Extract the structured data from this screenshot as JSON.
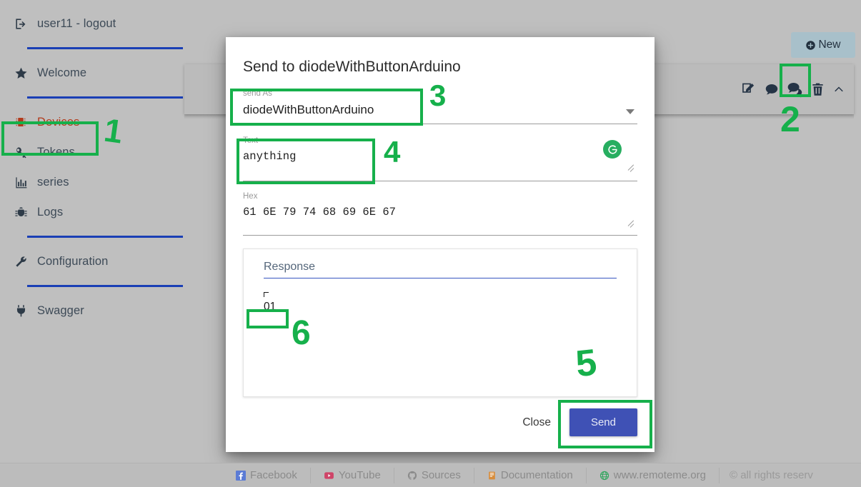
{
  "sidebar": {
    "account": {
      "label": "user11 - logout",
      "icon": "sign-out-icon"
    },
    "items": [
      {
        "label": "Welcome",
        "icon": "star-icon",
        "active": false
      },
      {
        "label": "Devices",
        "icon": "chip-icon",
        "active": true
      },
      {
        "label": "Tokens",
        "icon": "key-icon",
        "active": false
      },
      {
        "label": "series",
        "icon": "chart-icon",
        "active": false
      },
      {
        "label": "Logs",
        "icon": "bug-icon",
        "active": false
      },
      {
        "label": "Configuration",
        "icon": "wrench-icon",
        "active": false
      },
      {
        "label": "Swagger",
        "icon": "plug-icon",
        "active": false
      }
    ]
  },
  "toolbar": {
    "new_label": "New",
    "new_icon": "plus-circle-icon",
    "card_icons": [
      {
        "name": "edit-icon",
        "highlighted": false
      },
      {
        "name": "comment-icon",
        "highlighted": false
      },
      {
        "name": "comments-icon",
        "highlighted": true
      },
      {
        "name": "trash-icon",
        "highlighted": false
      },
      {
        "name": "chevron-up-icon",
        "highlighted": false
      }
    ]
  },
  "modal": {
    "title": "Send to diodeWithButtonArduino",
    "fields": {
      "send_as": {
        "label": "send As",
        "value": "diodeWithButtonArduino",
        "caret_icon": "chevron-down-icon"
      },
      "text": {
        "label": "Text",
        "value": "anything",
        "refresh_icon": "refresh-icon"
      },
      "hex": {
        "label": "Hex",
        "value": "61 6E 79 74 68 69 6E 67"
      }
    },
    "response": {
      "label": "Response",
      "value": "01"
    },
    "actions": {
      "close_label": "Close",
      "send_label": "Send"
    }
  },
  "footer": {
    "links": [
      {
        "label": "Facebook",
        "icon": "facebook-icon"
      },
      {
        "label": "YouTube",
        "icon": "youtube-icon"
      },
      {
        "label": "Sources",
        "icon": "github-icon"
      },
      {
        "label": "Documentation",
        "icon": "book-icon"
      },
      {
        "label": "www.remoteme.org",
        "icon": "globe-icon"
      }
    ],
    "copyright": "© all rights reserv"
  },
  "annotations": {
    "n1": "1",
    "n2": "2",
    "n3": "3",
    "n4": "4",
    "n5": "5",
    "n6": "6",
    "color": "#16b04b"
  }
}
